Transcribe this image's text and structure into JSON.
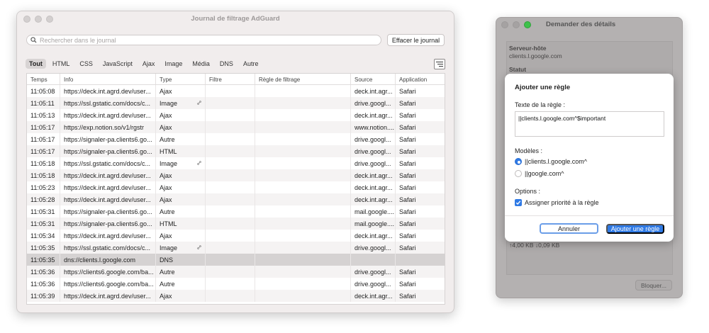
{
  "main_window": {
    "title": "Journal de filtrage AdGuard",
    "search": {
      "placeholder": "Rechercher dans le journal",
      "value": ""
    },
    "clear_button": "Effacer le journal",
    "filters": [
      {
        "label": "Tout",
        "active": true
      },
      {
        "label": "HTML",
        "active": false
      },
      {
        "label": "CSS",
        "active": false
      },
      {
        "label": "JavaScript",
        "active": false
      },
      {
        "label": "Ajax",
        "active": false
      },
      {
        "label": "Image",
        "active": false
      },
      {
        "label": "Média",
        "active": false
      },
      {
        "label": "DNS",
        "active": false
      },
      {
        "label": "Autre",
        "active": false
      }
    ],
    "table": {
      "headers": [
        "Temps",
        "Info",
        "Type",
        "Filtre",
        "Règle de filtrage",
        "Source",
        "Application"
      ],
      "rows": [
        {
          "time": "11:05:08",
          "info": "https://deck.int.agrd.dev/user...",
          "type": "Ajax",
          "link": false,
          "filter": "",
          "rule": "",
          "source": "deck.int.agr...",
          "app": "Safari"
        },
        {
          "time": "11:05:11",
          "info": "https://ssl.gstatic.com/docs/c...",
          "type": "Image",
          "link": true,
          "filter": "",
          "rule": "",
          "source": "drive.googl...",
          "app": "Safari"
        },
        {
          "time": "11:05:13",
          "info": "https://deck.int.agrd.dev/user...",
          "type": "Ajax",
          "link": false,
          "filter": "",
          "rule": "",
          "source": "deck.int.agr...",
          "app": "Safari"
        },
        {
          "time": "11:05:17",
          "info": "https://exp.notion.so/v1/rgstr",
          "type": "Ajax",
          "link": false,
          "filter": "",
          "rule": "",
          "source": "www.notion....",
          "app": "Safari"
        },
        {
          "time": "11:05:17",
          "info": "https://signaler-pa.clients6.go...",
          "type": "Autre",
          "link": false,
          "filter": "",
          "rule": "",
          "source": "drive.googl...",
          "app": "Safari"
        },
        {
          "time": "11:05:17",
          "info": "https://signaler-pa.clients6.go...",
          "type": "HTML",
          "link": false,
          "filter": "",
          "rule": "",
          "source": "drive.googl...",
          "app": "Safari"
        },
        {
          "time": "11:05:18",
          "info": "https://ssl.gstatic.com/docs/c...",
          "type": "Image",
          "link": true,
          "filter": "",
          "rule": "",
          "source": "drive.googl...",
          "app": "Safari"
        },
        {
          "time": "11:05:18",
          "info": "https://deck.int.agrd.dev/user...",
          "type": "Ajax",
          "link": false,
          "filter": "",
          "rule": "",
          "source": "deck.int.agr...",
          "app": "Safari"
        },
        {
          "time": "11:05:23",
          "info": "https://deck.int.agrd.dev/user...",
          "type": "Ajax",
          "link": false,
          "filter": "",
          "rule": "",
          "source": "deck.int.agr...",
          "app": "Safari"
        },
        {
          "time": "11:05:28",
          "info": "https://deck.int.agrd.dev/user...",
          "type": "Ajax",
          "link": false,
          "filter": "",
          "rule": "",
          "source": "deck.int.agr...",
          "app": "Safari"
        },
        {
          "time": "11:05:31",
          "info": "https://signaler-pa.clients6.go...",
          "type": "Autre",
          "link": false,
          "filter": "",
          "rule": "",
          "source": "mail.google....",
          "app": "Safari"
        },
        {
          "time": "11:05:31",
          "info": "https://signaler-pa.clients6.go...",
          "type": "HTML",
          "link": false,
          "filter": "",
          "rule": "",
          "source": "mail.google....",
          "app": "Safari"
        },
        {
          "time": "11:05:34",
          "info": "https://deck.int.agrd.dev/user...",
          "type": "Ajax",
          "link": false,
          "filter": "",
          "rule": "",
          "source": "deck.int.agr...",
          "app": "Safari"
        },
        {
          "time": "11:05:35",
          "info": "https://ssl.gstatic.com/docs/c...",
          "type": "Image",
          "link": true,
          "filter": "",
          "rule": "",
          "source": "drive.googl...",
          "app": "Safari"
        },
        {
          "time": "11:05:35",
          "info": "dns://clients.l.google.com",
          "type": "DNS",
          "link": false,
          "filter": "",
          "rule": "",
          "source": "",
          "app": "",
          "selected": true
        },
        {
          "time": "11:05:36",
          "info": "https://clients6.google.com/ba...",
          "type": "Autre",
          "link": false,
          "filter": "",
          "rule": "",
          "source": "drive.googl...",
          "app": "Safari"
        },
        {
          "time": "11:05:36",
          "info": "https://clients6.google.com/ba...",
          "type": "Autre",
          "link": false,
          "filter": "",
          "rule": "",
          "source": "drive.googl...",
          "app": "Safari"
        },
        {
          "time": "11:05:39",
          "info": "https://deck.int.agrd.dev/user...",
          "type": "Ajax",
          "link": false,
          "filter": "",
          "rule": "",
          "source": "deck.int.agr...",
          "app": "Safari"
        }
      ]
    }
  },
  "details_window": {
    "title": "Demander des détails",
    "host_label": "Serveur-hôte",
    "host_value": "clients.l.google.com",
    "status_label": "Statut",
    "size_value": "↑4,00 KB ↓0,09 KB",
    "block_button": "Bloquer..."
  },
  "dialog": {
    "title": "Ajouter une règle",
    "rule_text_label": "Texte de la règle :",
    "rule_text_value": "||clients.l.google.com^$important",
    "templates_label": "Modèles :",
    "templates": [
      {
        "label": "||clients.l.google.com^",
        "selected": true
      },
      {
        "label": "||google.com^",
        "selected": false
      }
    ],
    "options_label": "Options :",
    "option_priority": {
      "label": "Assigner priorité à la règle",
      "checked": true
    },
    "cancel_button": "Annuler",
    "add_button": "Ajouter une règle"
  },
  "colors": {
    "accent": "#2f7ae5",
    "selected_row": "#d5d2d2",
    "traffic_green": "#3ec14b"
  }
}
